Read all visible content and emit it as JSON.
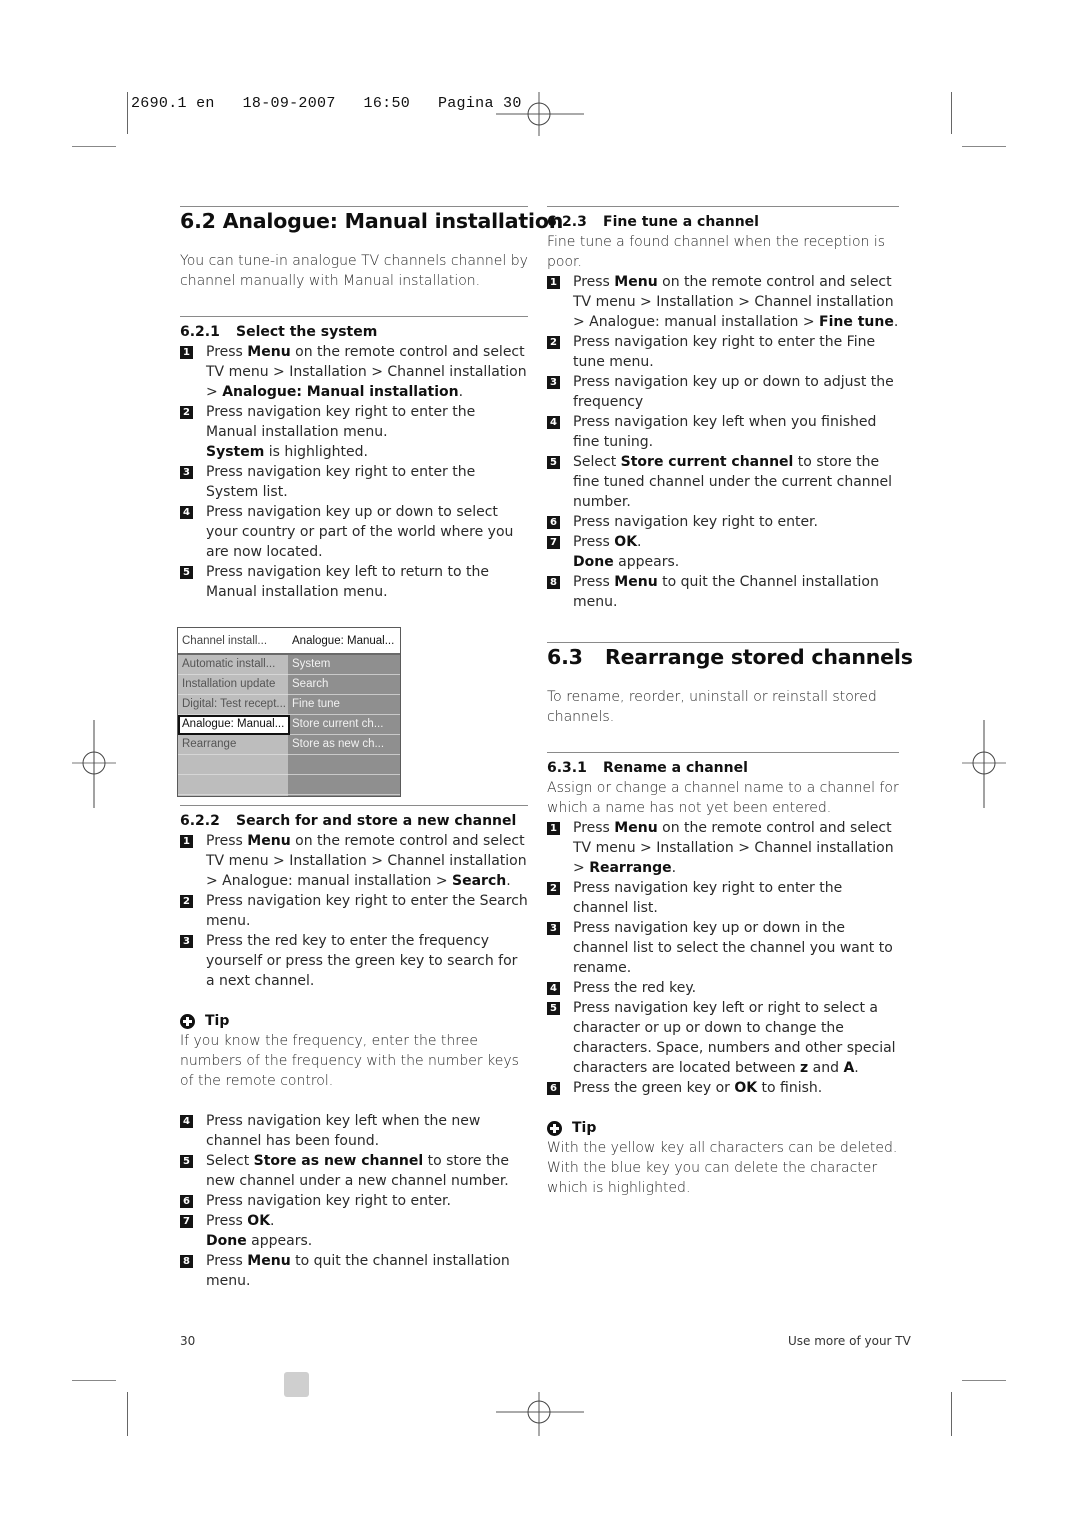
{
  "slug": "2690.1 en   18-09-2007   16:50   Pagina 30",
  "left": {
    "section": {
      "number": "6.2",
      "title": "Analogue: Manual installation"
    },
    "intro": "You can tune-in analogue TV channels channel by channel manually with Manual installation.",
    "sub1": {
      "number": "6.2.1",
      "title": "Select the system",
      "steps": [
        {
          "n": "1",
          "pre": "Press ",
          "b1": "Menu",
          "mid": " on the remote control and select TV menu > Installation > Channel installation > ",
          "b2": "Analogue: Manual installation",
          "post": "."
        },
        {
          "n": "2",
          "pre": "Press navigation key right to enter the Manual installation menu.",
          "sub_b": "System",
          "sub_post": " is highlighted."
        },
        {
          "n": "3",
          "pre": "Press navigation key right to enter the System list."
        },
        {
          "n": "4",
          "pre": "Press navigation key up or down to select your country or part of the world where you are now located."
        },
        {
          "n": "5",
          "pre": "Press navigation key left to return to the Manual installation menu."
        }
      ]
    },
    "tvmenu": {
      "header_left": "Channel install...",
      "header_right": "Analogue: Manual...",
      "left_items": [
        "Automatic install...",
        "Installation update",
        "Digital: Test recept...",
        "Analogue: Manual...",
        "Rearrange",
        "",
        ""
      ],
      "selected_index": 3,
      "right_items": [
        "System",
        "Search",
        "Fine tune",
        "Store current ch...",
        "Store as new ch...",
        "",
        ""
      ]
    },
    "sub2": {
      "number": "6.2.2",
      "title": "Search for and store a new channel",
      "steps_a": [
        {
          "n": "1",
          "pre": "Press ",
          "b1": "Menu",
          "mid": " on the remote control and select TV menu > Installation > Channel installation > Analogue: manual installation > ",
          "b2": "Search",
          "post": "."
        },
        {
          "n": "2",
          "pre": "Press navigation key right to enter the Search menu."
        },
        {
          "n": "3",
          "pre": "Press the red key to enter the frequency yourself or press the green key to search for a next channel."
        }
      ],
      "tip_label": "Tip",
      "tip_text": "If you know the frequency, enter the three numbers of the frequency with the number keys of the remote control.",
      "steps_b": [
        {
          "n": "4",
          "pre": "Press navigation key left when the new channel has been found."
        },
        {
          "n": "5",
          "pre": "Select ",
          "b1": "Store as new channel",
          "mid": " to store the new channel under a new channel number."
        },
        {
          "n": "6",
          "pre": "Press navigation key right to enter."
        },
        {
          "n": "7",
          "pre": "Press ",
          "b1": "OK",
          "mid": ".",
          "sub_b": "Done",
          "sub_post": " appears."
        },
        {
          "n": "8",
          "pre": "Press ",
          "b1": "Menu",
          "mid": " to quit the channel installation menu."
        }
      ]
    }
  },
  "right": {
    "sub3": {
      "number": "6.2.3",
      "title": "Fine tune a channel",
      "intro": "Fine tune a found channel when the reception is poor.",
      "steps": [
        {
          "n": "1",
          "pre": "Press ",
          "b1": "Menu",
          "mid": " on the remote control and select TV menu > Installation > Channel installation > Analogue: manual installation > ",
          "b2": "Fine tune",
          "post": "."
        },
        {
          "n": "2",
          "pre": "Press navigation key right to enter the Fine tune menu."
        },
        {
          "n": "3",
          "pre": "Press navigation key up or down to adjust the frequency"
        },
        {
          "n": "4",
          "pre": "Press navigation key left when you finished fine tuning."
        },
        {
          "n": "5",
          "pre": "Select ",
          "b1": "Store current channel",
          "mid": " to store the fine tuned channel under the current channel number."
        },
        {
          "n": "6",
          "pre": "Press navigation key right to enter."
        },
        {
          "n": "7",
          "pre": "Press ",
          "b1": "OK",
          "mid": ".",
          "sub_b": "Done",
          "sub_post": " appears."
        },
        {
          "n": "8",
          "pre": "Press ",
          "b1": "Menu",
          "mid": " to quit the Channel installation menu."
        }
      ]
    },
    "section": {
      "number": "6.3",
      "title": "Rearrange stored channels"
    },
    "intro": "To rename, reorder, uninstall or reinstall stored channels.",
    "sub4": {
      "number": "6.3.1",
      "title": "Rename a channel",
      "intro": "Assign or change a channel name to a channel for which a name has not yet been entered.",
      "steps": [
        {
          "n": "1",
          "pre": "Press ",
          "b1": "Menu",
          "mid": " on the remote control and select TV menu > Installation > Channel installation > ",
          "b2": "Rearrange",
          "post": "."
        },
        {
          "n": "2",
          "pre": "Press navigation key right to enter the channel list."
        },
        {
          "n": "3",
          "pre": "Press navigation key up or down in the channel list to select the channel you want to rename."
        },
        {
          "n": "4",
          "pre": "Press the red key."
        },
        {
          "n": "5",
          "pre": "Press navigation key left or right to select a character or up or down to change the characters. Space, numbers and other special characters are located between ",
          "b1": "z",
          "mid": " and ",
          "b2": "A",
          "post": "."
        },
        {
          "n": "6",
          "pre": "Press the green key or ",
          "b1": "OK",
          "mid": " to finish."
        }
      ],
      "tip_label": "Tip",
      "tip_text": "With the yellow key all characters can be deleted. With the blue key you can delete the character which is highlighted."
    }
  },
  "footer": {
    "page_number": "30",
    "chapter": "Use more of your TV"
  }
}
